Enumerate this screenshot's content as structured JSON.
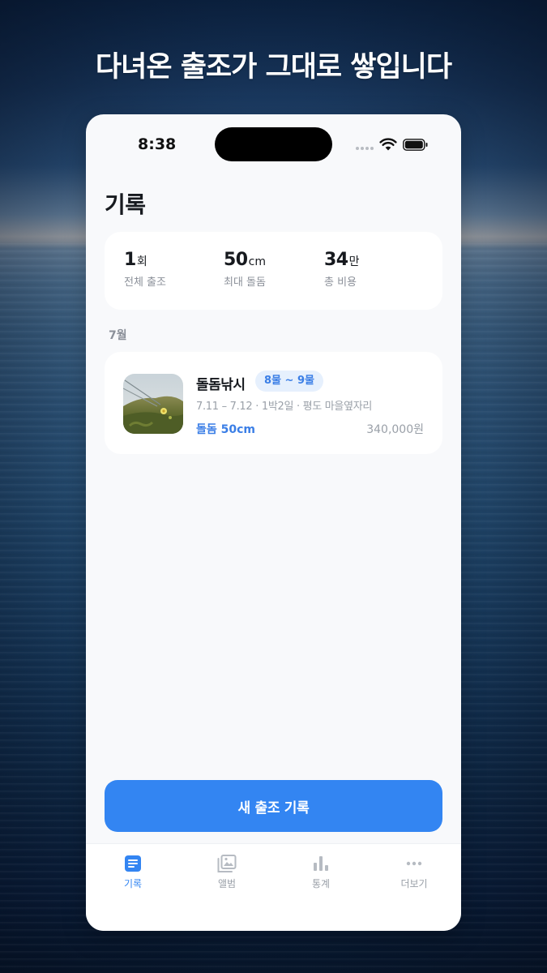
{
  "headline": "다녀온 출조가 그대로 쌓입니다",
  "status_bar": {
    "time": "8:38"
  },
  "page": {
    "title": "기록"
  },
  "stats": [
    {
      "value": "1",
      "unit": "회",
      "label": "전체 출조"
    },
    {
      "value": "50",
      "unit": "cm",
      "label": "최대 돌돔"
    },
    {
      "value": "34",
      "unit": "만",
      "label": "총 비용"
    }
  ],
  "month_label": "7월",
  "trip": {
    "title": "돌돔낚시",
    "tide_badge": "8물 ~ 9물",
    "meta": "7.11 – 7.12 · 1박2일 · 평도 마을옆자리",
    "catch": "돌돔 50cm",
    "cost": "340,000원"
  },
  "actions": {
    "new_trip_label": "새 출조 기록"
  },
  "tab_bar": {
    "items": [
      {
        "label": "기록",
        "icon": "document-icon",
        "active": true
      },
      {
        "label": "앨범",
        "icon": "photo-album-icon",
        "active": false
      },
      {
        "label": "통계",
        "icon": "bar-chart-icon",
        "active": false
      },
      {
        "label": "더보기",
        "icon": "more-dots-icon",
        "active": false
      }
    ]
  },
  "colors": {
    "accent": "#3385f2",
    "badge_bg": "#e6f0fd",
    "screen_bg": "#f8f9fb"
  }
}
